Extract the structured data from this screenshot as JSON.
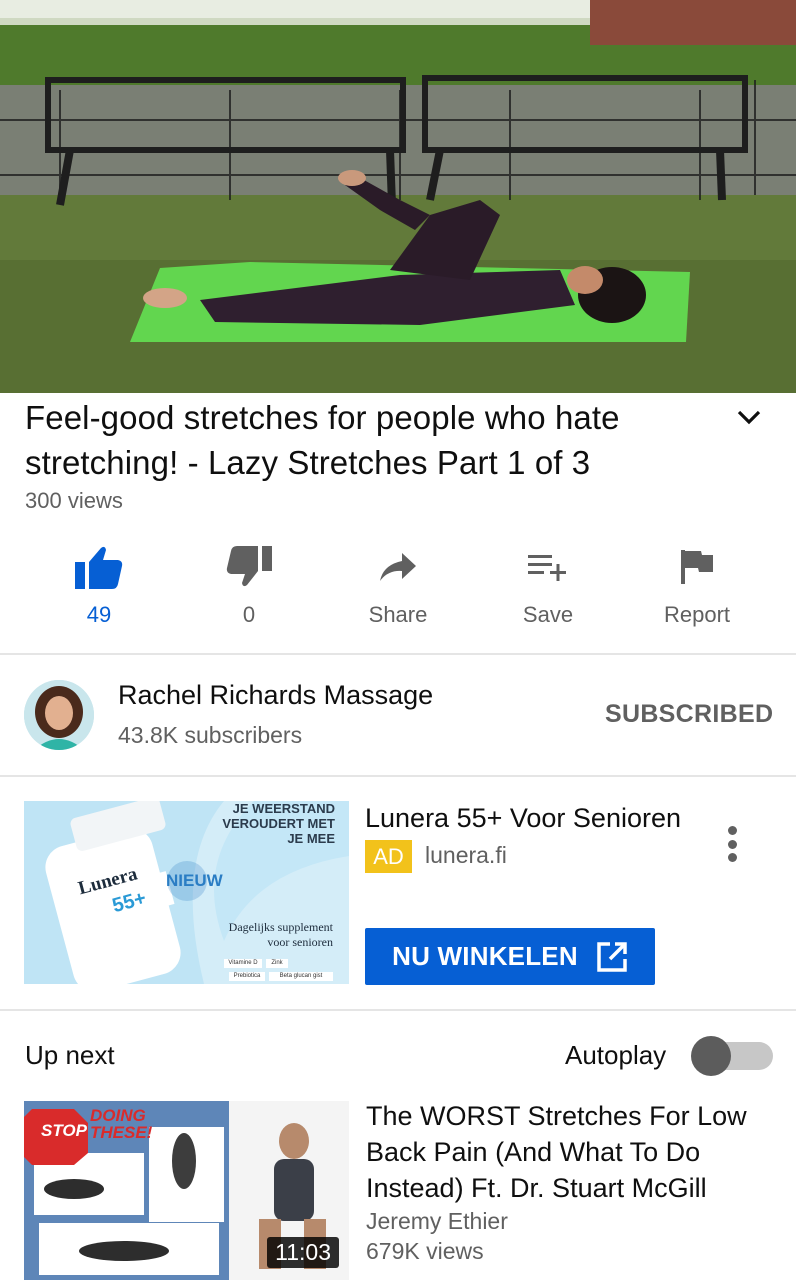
{
  "video": {
    "title": "Feel-good stretches for people who hate stretching! - Lazy Stretches Part 1 of 3",
    "views": "300 views"
  },
  "actions": {
    "like_count": "49",
    "dislike_count": "0",
    "share_label": "Share",
    "save_label": "Save",
    "report_label": "Report"
  },
  "channel": {
    "name": "Rachel Richards Massage",
    "subscribers": "43.8K subscribers",
    "subscribe_state": "SUBSCRIBED"
  },
  "ad": {
    "title": "Lunera 55+ Voor Senioren",
    "badge": "AD",
    "domain": "lunera.fi",
    "cta_label": "NU WINKELEN",
    "image_text": {
      "headline_1": "JE WEERSTAND",
      "headline_2": "VEROUDERT MET",
      "headline_3": "JE MEE",
      "brand": "Lunera",
      "brand_number": "55+",
      "new_label": "NIEUW",
      "tagline_1": "Dagelijks supplement",
      "tagline_2": "voor senioren",
      "chip_1": "Vitamine D",
      "chip_2": "Zink",
      "chip_3": "Prebiotica",
      "chip_4": "Beta glucan gist"
    }
  },
  "up_next": {
    "label": "Up next",
    "autoplay_label": "Autoplay",
    "autoplay_on": false,
    "video": {
      "title": "The WORST Stretches For Low Back Pain (And What To Do Instead) Ft. Dr. Stuart McGill",
      "channel": "Jeremy Ethier",
      "views": "679K views",
      "duration": "11:03",
      "thumb_text_1": "STOP",
      "thumb_text_2": "DOING",
      "thumb_text_3": "THESE!"
    }
  },
  "colors": {
    "accent_blue": "#065fd4",
    "ad_badge": "#f2c21b",
    "secondary_text": "#606060"
  }
}
